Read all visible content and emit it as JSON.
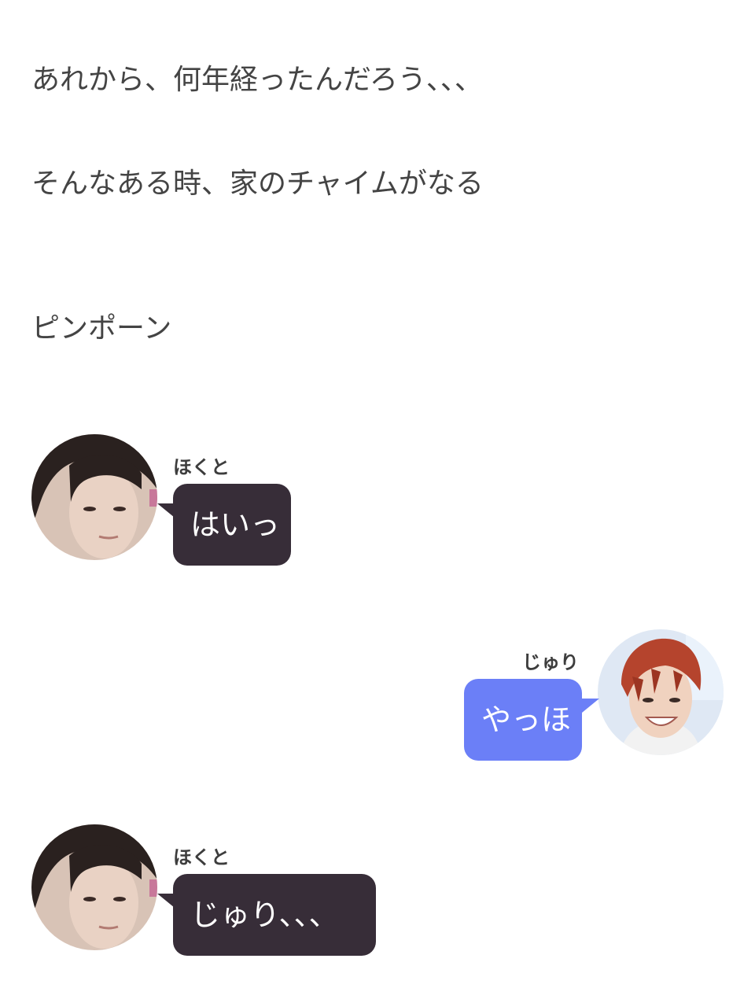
{
  "narration": [
    "あれから、何年経ったんだろう、、、",
    "そんなある時、家のチャイムがなる",
    "ピンポーン"
  ],
  "messages": [
    {
      "speaker": "ほくと",
      "text": "はいっ",
      "side": "left",
      "bubble_color": "#372d38"
    },
    {
      "speaker": "じゅり",
      "text": "やっほ",
      "side": "right",
      "bubble_color": "#6b7ff7"
    },
    {
      "speaker": "ほくと",
      "text": "じゅり、、、",
      "side": "left",
      "bubble_color": "#372d38"
    }
  ],
  "avatars": {
    "hokuto": "person-dark-hair-avatar",
    "juri": "person-red-hair-avatar"
  }
}
